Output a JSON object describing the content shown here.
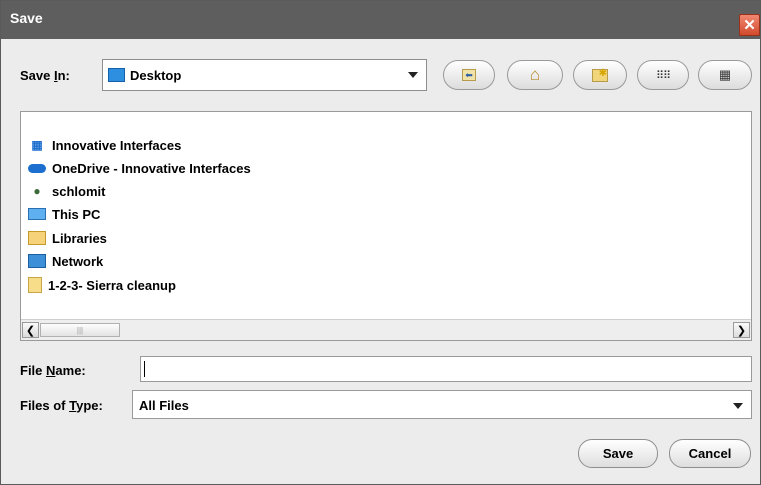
{
  "window": {
    "title": "Save",
    "close_glyph": "✕"
  },
  "save_in": {
    "label": "Save In:",
    "value": "Desktop",
    "icon": "desktop-folder-icon"
  },
  "toolbar": [
    {
      "name": "up-one-level-button",
      "icon": "up-folder-icon"
    },
    {
      "name": "home-button",
      "icon": "home-icon"
    },
    {
      "name": "new-folder-button",
      "icon": "new-folder-icon"
    },
    {
      "name": "list-view-button",
      "icon": "list-view-icon"
    },
    {
      "name": "details-view-button",
      "icon": "details-view-icon"
    }
  ],
  "files": [
    {
      "label": "Innovative Interfaces",
      "icon": "building-icon"
    },
    {
      "label": "OneDrive - Innovative Interfaces",
      "icon": "onedrive-cloud-icon"
    },
    {
      "label": "schlomit",
      "icon": "user-icon"
    },
    {
      "label": "This PC",
      "icon": "computer-icon"
    },
    {
      "label": "Libraries",
      "icon": "libraries-icon"
    },
    {
      "label": "Network",
      "icon": "network-icon"
    },
    {
      "label": "1-2-3- Sierra cleanup",
      "icon": "folder-icon"
    }
  ],
  "file_name": {
    "label": "File Name:",
    "value": ""
  },
  "files_of_type": {
    "label": "Files of Type:",
    "value": "All Files"
  },
  "buttons": {
    "save": "Save",
    "cancel": "Cancel"
  },
  "colors": {
    "titlebar": "#5e5e5e",
    "close": "#d24a2c",
    "background": "#ececec"
  }
}
